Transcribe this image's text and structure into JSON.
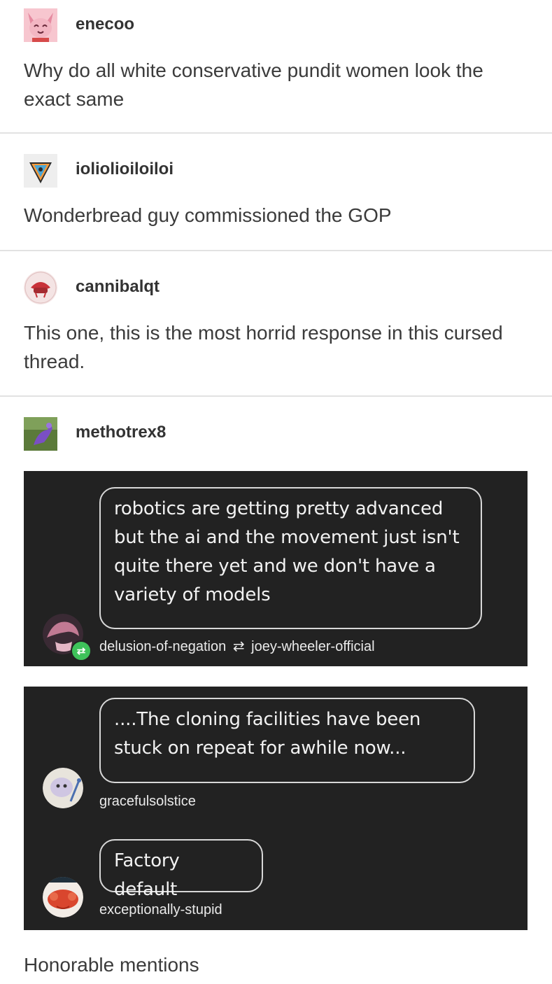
{
  "posts": [
    {
      "username": "enecoo",
      "text": "Why do all white conservative pundit women look the exact same"
    },
    {
      "username": "ioliolioiloiloi",
      "text": "Wonderbread guy commissioned the GOP"
    },
    {
      "username": "cannibalqt",
      "text": "This one, this is the most horrid response in this cursed thread."
    },
    {
      "username": "methotrex8"
    }
  ],
  "screenshot1": {
    "message": "robotics are getting pretty advanced but the ai and the movement just isn't quite there yet and we don't have a variety of models",
    "author": "delusion-of-negation",
    "reblog_icon": "⇄",
    "reblogged_from": "joey-wheeler-official"
  },
  "screenshot2": {
    "messages": [
      {
        "text": "....The cloning facilities have been stuck on repeat for awhile now...",
        "author": "gracefulsolstice"
      },
      {
        "text": "Factory default",
        "author": "exceptionally-stupid"
      }
    ]
  },
  "footer_text": "Honorable mentions",
  "colors": {
    "chat_bg": "#222222",
    "badge": "#3ec25a",
    "divider": "#e2e2e2"
  }
}
